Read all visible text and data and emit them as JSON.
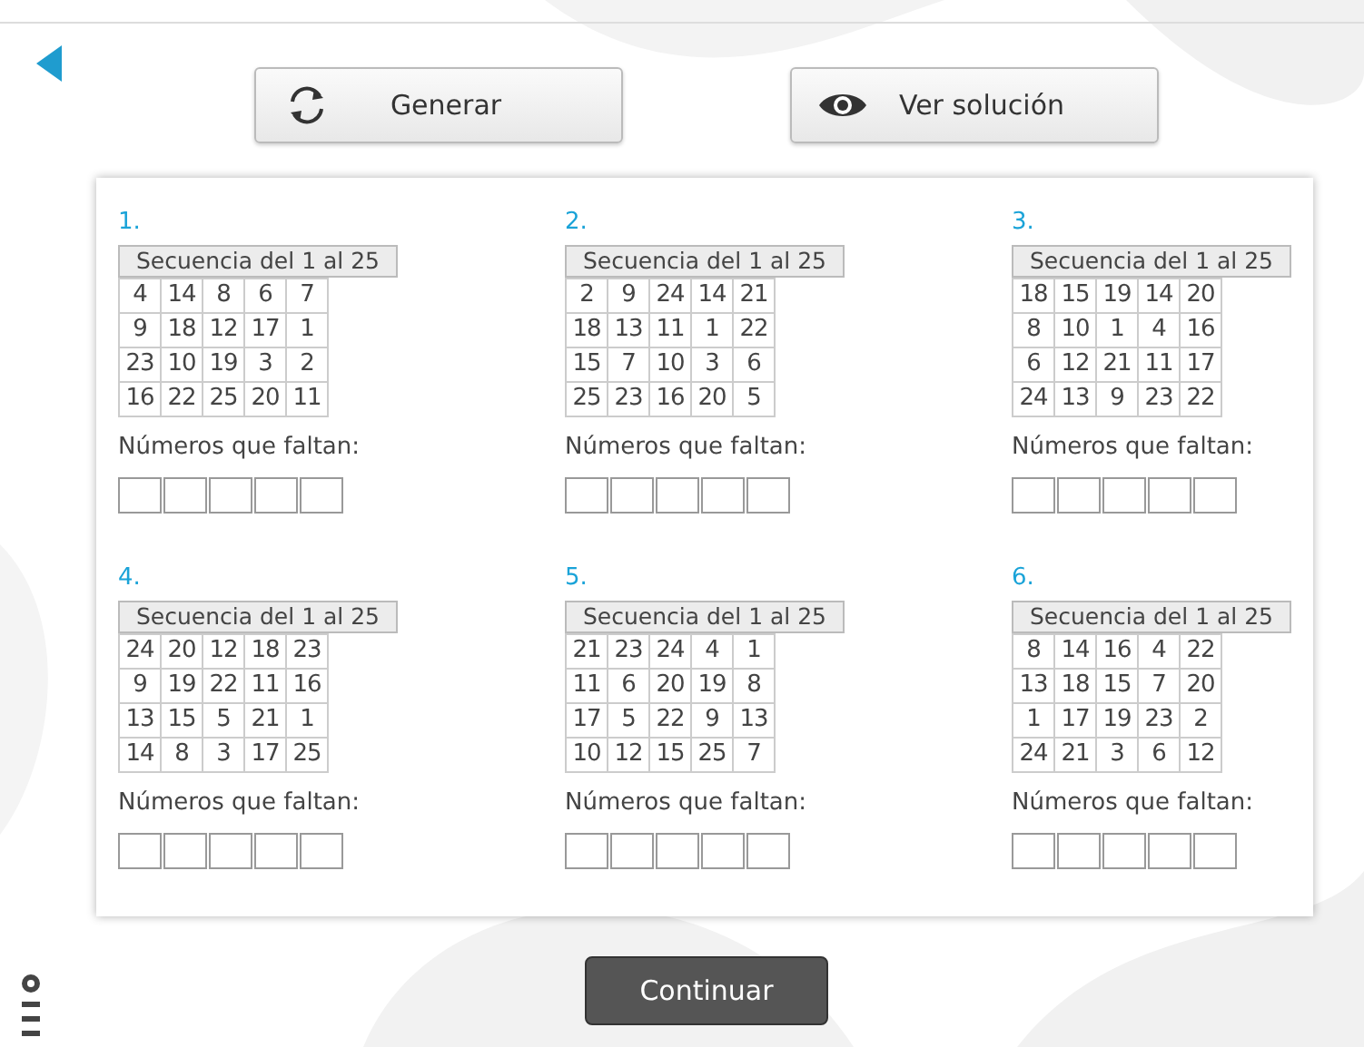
{
  "toolbar": {
    "buttons": [
      {
        "kind": "refresh",
        "label": "Generar"
      },
      {
        "kind": "eye",
        "label": "Ver solución"
      }
    ]
  },
  "exercises": [
    {
      "number": "1.",
      "header": "Secuencia del 1 al 25",
      "rows": [
        [
          "4",
          "14",
          "8",
          "6",
          "7"
        ],
        [
          "9",
          "18",
          "12",
          "17",
          "1"
        ],
        [
          "23",
          "10",
          "19",
          "3",
          "2"
        ],
        [
          "16",
          "22",
          "25",
          "20",
          "11"
        ]
      ],
      "prompt": "Números que faltan:"
    },
    {
      "number": "2.",
      "header": "Secuencia del 1 al 25",
      "rows": [
        [
          "2",
          "9",
          "24",
          "14",
          "21"
        ],
        [
          "18",
          "13",
          "11",
          "1",
          "22"
        ],
        [
          "15",
          "7",
          "10",
          "3",
          "6"
        ],
        [
          "25",
          "23",
          "16",
          "20",
          "5"
        ]
      ],
      "prompt": "Números que faltan:"
    },
    {
      "number": "3.",
      "header": "Secuencia del 1 al 25",
      "rows": [
        [
          "18",
          "15",
          "19",
          "14",
          "20"
        ],
        [
          "8",
          "10",
          "1",
          "4",
          "16"
        ],
        [
          "6",
          "12",
          "21",
          "11",
          "17"
        ],
        [
          "24",
          "13",
          "9",
          "23",
          "22"
        ]
      ],
      "prompt": "Números que faltan:"
    },
    {
      "number": "4.",
      "header": "Secuencia del 1 al 25",
      "rows": [
        [
          "24",
          "20",
          "12",
          "18",
          "23"
        ],
        [
          "9",
          "19",
          "22",
          "11",
          "16"
        ],
        [
          "13",
          "15",
          "5",
          "21",
          "1"
        ],
        [
          "14",
          "8",
          "3",
          "17",
          "25"
        ]
      ],
      "prompt": "Números que faltan:"
    },
    {
      "number": "5.",
      "header": "Secuencia del 1 al 25",
      "rows": [
        [
          "21",
          "23",
          "24",
          "4",
          "1"
        ],
        [
          "11",
          "6",
          "20",
          "19",
          "8"
        ],
        [
          "17",
          "5",
          "22",
          "9",
          "13"
        ],
        [
          "10",
          "12",
          "15",
          "25",
          "7"
        ]
      ],
      "prompt": "Números que faltan:"
    },
    {
      "number": "6.",
      "header": "Secuencia del 1 al 25",
      "rows": [
        [
          "8",
          "14",
          "16",
          "4",
          "22"
        ],
        [
          "13",
          "18",
          "15",
          "7",
          "20"
        ],
        [
          "1",
          "17",
          "19",
          "23",
          "2"
        ],
        [
          "24",
          "21",
          "3",
          "6",
          "12"
        ]
      ],
      "prompt": "Números que faltan:"
    }
  ],
  "continue_button": "Continuar"
}
